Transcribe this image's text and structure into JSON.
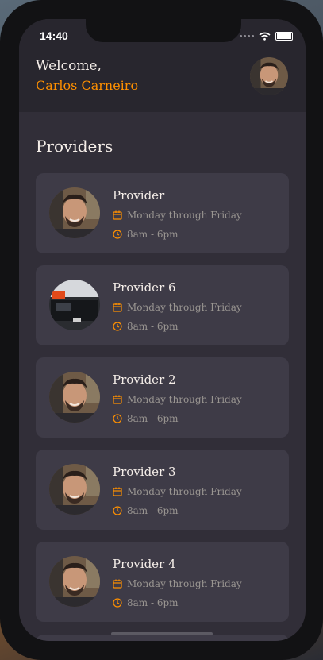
{
  "status_bar": {
    "time": "14:40",
    "signal_icon": "signal-icon",
    "wifi_icon": "wifi-icon",
    "battery_icon": "battery-icon"
  },
  "header": {
    "greeting": "Welcome,",
    "user_name": "Carlos Carneiro"
  },
  "section_title": "Providers",
  "providers": [
    {
      "name": "Provider",
      "days": "Monday through Friday",
      "hours": "8am - 6pm",
      "avatar": "person"
    },
    {
      "name": "Provider 6",
      "days": "Monday through Friday",
      "hours": "8am - 6pm",
      "avatar": "car"
    },
    {
      "name": "Provider 2",
      "days": "Monday through Friday",
      "hours": "8am - 6pm",
      "avatar": "person"
    },
    {
      "name": "Provider 3",
      "days": "Monday through Friday",
      "hours": "8am - 6pm",
      "avatar": "person"
    },
    {
      "name": "Provider 4",
      "days": "Monday through Friday",
      "hours": "8am - 6pm",
      "avatar": "person"
    }
  ],
  "colors": {
    "accent": "#ff9000",
    "background": "#312e38",
    "card": "#3e3b47",
    "header": "#28262e",
    "text": "#f4ede8",
    "muted": "#999591"
  }
}
